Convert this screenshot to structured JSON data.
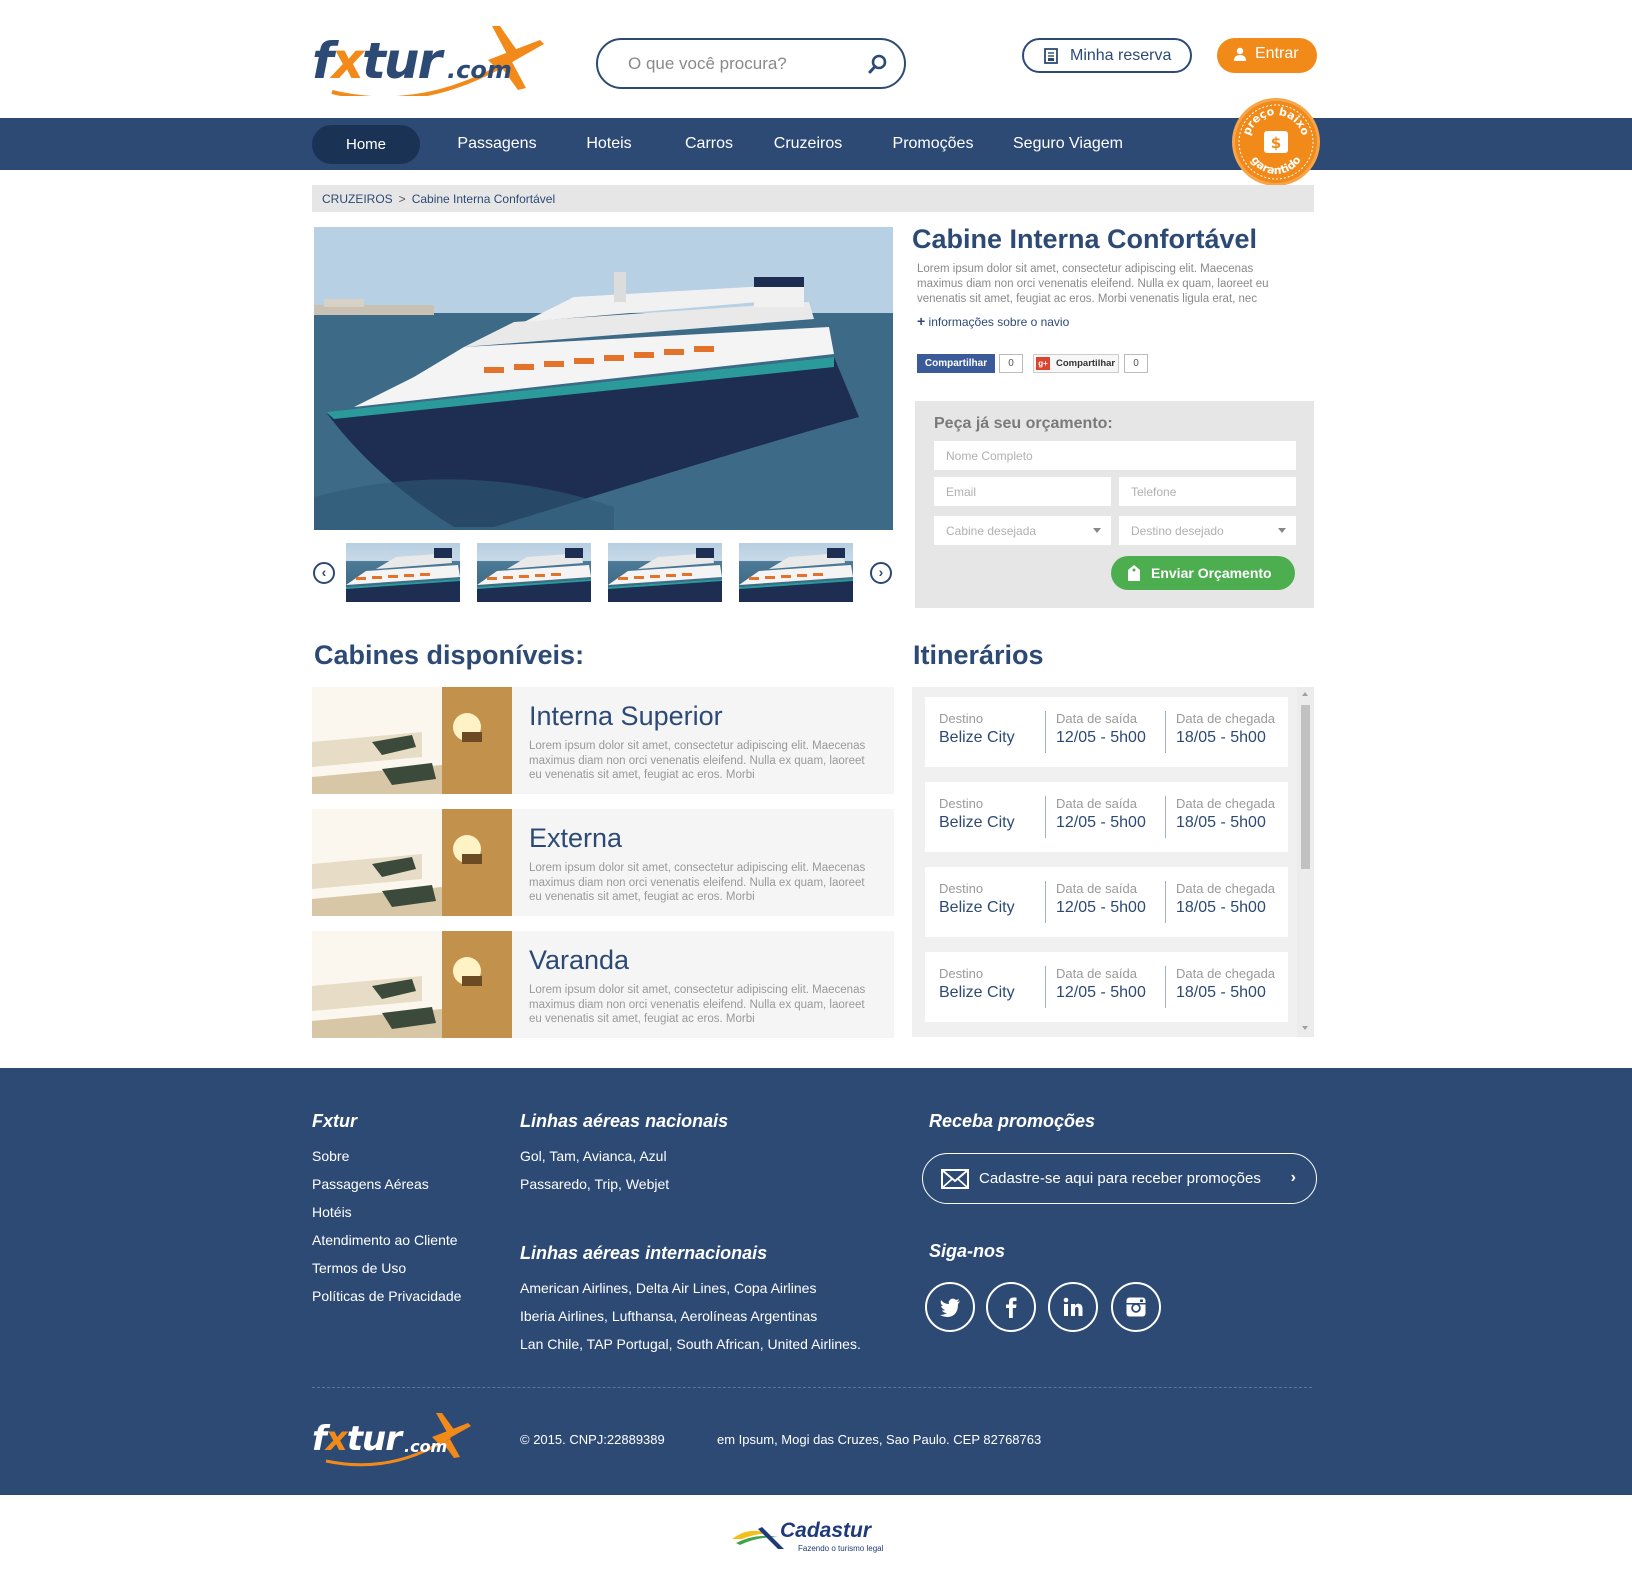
{
  "brand": {
    "name_main": "fxtur",
    "name_x": "x",
    "name_suffix": ".com"
  },
  "header": {
    "search_placeholder": "O que você procura?",
    "reserva_label": "Minha reserva",
    "entrar_label": "Entrar"
  },
  "nav": {
    "items": [
      {
        "label": "Home",
        "active": true
      },
      {
        "label": "Passagens"
      },
      {
        "label": "Hoteis"
      },
      {
        "label": "Carros"
      },
      {
        "label": "Cruzeiros"
      },
      {
        "label": "Promoções"
      },
      {
        "label": "Seguro Viagem"
      }
    ],
    "badge_text": "preço baixo garantido"
  },
  "breadcrumb": {
    "section": "CRUZEIROS",
    "separator": ">",
    "current": "Cabine Interna Confortável"
  },
  "product": {
    "title": "Cabine Interna Confortável",
    "description": "Lorem ipsum dolor sit amet, consectetur adipiscing elit. Maecenas maximus diam non orci venenatis eleifend. Nulla ex quam, laoreet eu venenatis sit amet, feugiat ac eros. Morbi venenatis ligula erat, nec",
    "more_link": "informações sobre o navio",
    "share_fb_label": "Compartilhar",
    "share_fb_count": "0",
    "share_gp_label": "Compartilhar",
    "share_gp_count": "0"
  },
  "gallery": {
    "prev": "‹",
    "next": "›"
  },
  "quote": {
    "title": "Peça já seu orçamento:",
    "name_placeholder": "Nome Completo",
    "email_placeholder": "Email",
    "phone_placeholder": "Telefone",
    "cabin_placeholder": "Cabine desejada",
    "destino_placeholder": "Destino desejado",
    "submit_label": "Enviar Orçamento"
  },
  "cabines": {
    "title": "Cabines disponíveis:",
    "items": [
      {
        "name": "Interna Superior",
        "desc": "Lorem ipsum dolor sit amet, consectetur adipiscing elit. Maecenas maximus diam non orci venenatis eleifend. Nulla ex quam, laoreet eu venenatis sit amet, feugiat ac eros. Morbi"
      },
      {
        "name": "Externa",
        "desc": "Lorem ipsum dolor sit amet, consectetur adipiscing elit. Maecenas maximus diam non orci venenatis eleifend. Nulla ex quam, laoreet eu venenatis sit amet, feugiat ac eros. Morbi"
      },
      {
        "name": "Varanda",
        "desc": "Lorem ipsum dolor sit amet, consectetur adipiscing elit. Maecenas maximus diam non orci venenatis eleifend. Nulla ex quam, laoreet eu venenatis sit amet, feugiat ac eros. Morbi"
      }
    ]
  },
  "itinerarios": {
    "title": "Itinerários",
    "labels": {
      "destino": "Destino",
      "saida": "Data de saída",
      "chegada": "Data de chegada"
    },
    "rows": [
      {
        "destino": "Belize City",
        "saida": "12/05 - 5h00",
        "chegada": "18/05 - 5h00"
      },
      {
        "destino": "Belize City",
        "saida": "12/05 - 5h00",
        "chegada": "18/05 - 5h00"
      },
      {
        "destino": "Belize City",
        "saida": "12/05 - 5h00",
        "chegada": "18/05 - 5h00"
      },
      {
        "destino": "Belize City",
        "saida": "12/05 - 5h00",
        "chegada": "18/05 - 5h00"
      }
    ]
  },
  "footer": {
    "col1_title": "Fxtur",
    "col1_links": [
      "Sobre",
      "Passagens Aéreas",
      "Hotéis",
      "Atendimento ao Cliente",
      "Termos de Uso",
      "Políticas de Privacidade"
    ],
    "nacionais_title": "Linhas aéreas nacionais",
    "nacionais": [
      "Gol, Tam, Avianca, Azul",
      "Passaredo, Trip, Webjet"
    ],
    "internacionais_title": "Linhas aéreas internacionais",
    "internacionais": [
      "American Airlines, Delta Air Lines, Copa Airlines",
      "Iberia Airlines, Lufthansa, Aerolíneas Argentinas",
      "Lan Chile, TAP Portugal, South African, United Airlines."
    ],
    "promo_title": "Receba promoções",
    "promo_label": "Cadastre-se aqui para receber promoções",
    "social_title": "Siga-nos",
    "social": [
      "twitter-icon",
      "facebook-icon",
      "linkedin-icon",
      "instagram-icon"
    ],
    "copyright": "© 2015. CNPJ:22889389",
    "address": "em Ipsum, Mogi das Cruzes, Sao Paulo. CEP 82768763"
  },
  "cadastur": {
    "name": "Cadastur",
    "tagline": "Fazendo o turismo legal"
  },
  "colors": {
    "navy": "#2d4a75",
    "orange": "#f28a1a",
    "green": "#4cae4f",
    "panel_grey": "#e6e6e6"
  }
}
